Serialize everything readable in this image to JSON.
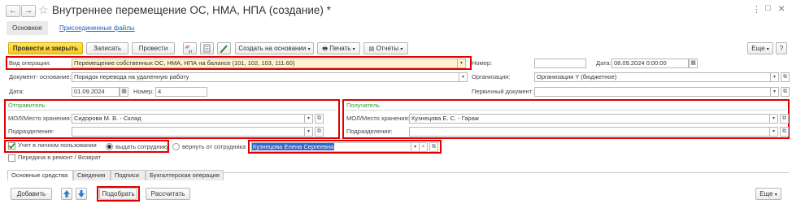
{
  "window": {
    "title": "Внутреннее перемещение ОС, НМА, НПА (создание) *",
    "back_glyph": "←",
    "forward_glyph": "→",
    "star_glyph": "☆",
    "menu_glyph": "⋮",
    "maximize_glyph": "□",
    "close_glyph": "×"
  },
  "top_tabs": {
    "main": "Основное",
    "attached": "Присоединенные файлы"
  },
  "toolbar": {
    "post_close": "Провести и закрыть",
    "save": "Записать",
    "post": "Провести",
    "create_basis": "Создать на основании",
    "print": "Печать",
    "reports": "Отчеты",
    "more": "Еще"
  },
  "form": {
    "op_type_label": "Вид операции:",
    "op_type_value": "Перемещение собственных ОС, НМА, НПА на балансе (101, 102, 103, 111.60)",
    "doc_basis_label": "Документ- основание:",
    "doc_basis_value": "Порядок перевода на удаленную работу",
    "date_label": "Дата:",
    "date_value": "01.09.2024",
    "number_label": "Номер:",
    "number_value": "4",
    "right_number_label": "Номер:",
    "right_number_value": "",
    "right_date_label": "Дата:",
    "right_date_value": "08.09.2024  0:00:00",
    "org_label": "Организация:",
    "org_value": "Организация Y (бюджетное)",
    "primary_doc_label": "Первичный документ:",
    "primary_doc_value": ""
  },
  "sender": {
    "header": "Отправитель",
    "mol_label": "МОЛ/Место хранения:",
    "mol_value": "Сидорова М. В. - Склад",
    "dept_label": "Подразделение:",
    "dept_value": ""
  },
  "receiver": {
    "header": "Получатель",
    "mol_label": "МОЛ/Место хранения:",
    "mol_value": "Кузнецова Е. С. - Гараж",
    "dept_label": "Подразделение:",
    "dept_value": ""
  },
  "personal_use": {
    "checkbox_label": "Учет в личном пользовании",
    "radio_give": "выдать сотруднику",
    "radio_return": "вернуть от сотрудника",
    "employee_value": "Кузнецова Елена Сергеевна"
  },
  "repair": {
    "label": "Передача в ремонт / Возврат"
  },
  "bottom_tabs": [
    "Основные средства",
    "Сведения",
    "Подписи",
    "Бухгалтерская операция"
  ],
  "table_toolbar": {
    "add": "Добавить",
    "pick": "Подобрать",
    "calculate": "Рассчитать",
    "more": "Еще"
  }
}
